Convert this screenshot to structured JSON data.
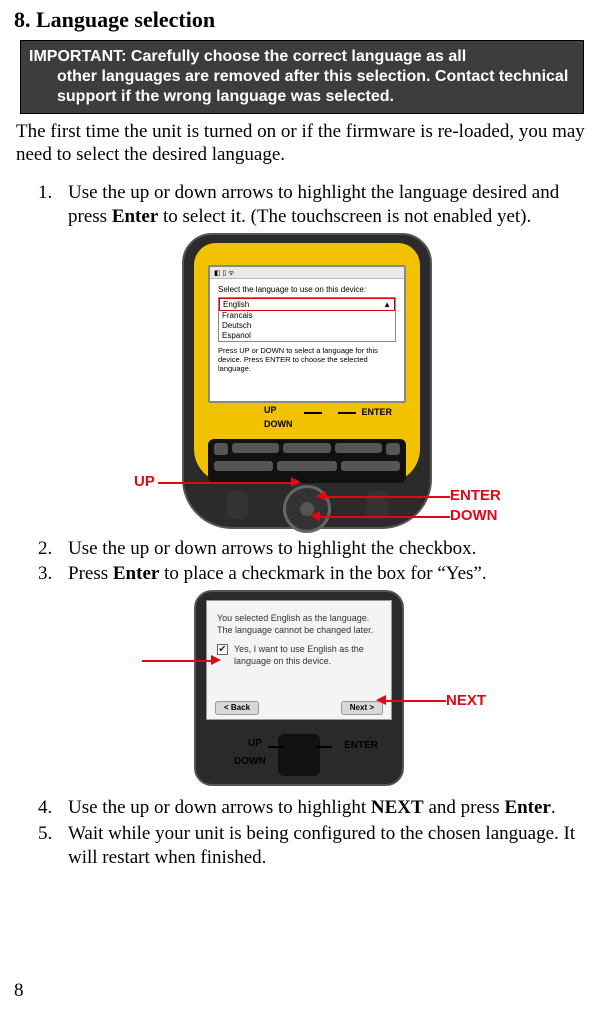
{
  "section": {
    "number": "8.",
    "title": "Language selection"
  },
  "important_box": {
    "lead": "IMPORTANT: Carefully choose the correct language as all",
    "rest": "other languages are removed after this selection. Contact technical support if the wrong language was selected."
  },
  "intro": "The first time the unit is turned on or if the firmware is re-loaded, you may need to select the desired language.",
  "steps": {
    "s1": {
      "num": "1.",
      "p1": "Use the up or down arrows to highlight the language desired and press ",
      "b1": "Enter",
      "p2": " to select it. (The touchscreen is not enabled yet)."
    },
    "s2": {
      "num": "2.",
      "p1": "Use the up or down arrows to highlight the checkbox."
    },
    "s3": {
      "num": "3.",
      "p1": "Press ",
      "b1": "Enter",
      "p2": " to place a checkmark in the box for “Yes”."
    },
    "s4": {
      "num": "4.",
      "p1": "Use the up or down arrows to highlight ",
      "b1": "NEXT",
      "p2": " and press ",
      "b2": "Enter",
      "p3": "."
    },
    "s5": {
      "num": "5.",
      "p1": "Wait while your unit is being configured to the chosen language. It will restart when finished."
    }
  },
  "figure1": {
    "labels": {
      "up": "UP",
      "enter": "ENTER",
      "down": "DOWN"
    },
    "screen": {
      "prompt": "Select the language to use on this device:",
      "options": [
        "English",
        "Francais",
        "Deutsch",
        "Espanol"
      ],
      "help": "Press UP or DOWN to select a language for this device. Press ENTER to choose the selected language."
    },
    "softkeys": {
      "up": "UP",
      "down": "DOWN",
      "enter": "ENTER"
    }
  },
  "figure2": {
    "labels": {
      "next": "NEXT"
    },
    "screen": {
      "line1": "You selected English as the language.",
      "line2": "The language cannot be changed later.",
      "checkbox_text": "Yes, I want to use English as the language on this device.",
      "back": "<   Back",
      "next": "Next   >"
    },
    "softkeys": {
      "up": "UP",
      "down": "DOWN",
      "enter": "ENTER"
    }
  },
  "page_number": "8"
}
